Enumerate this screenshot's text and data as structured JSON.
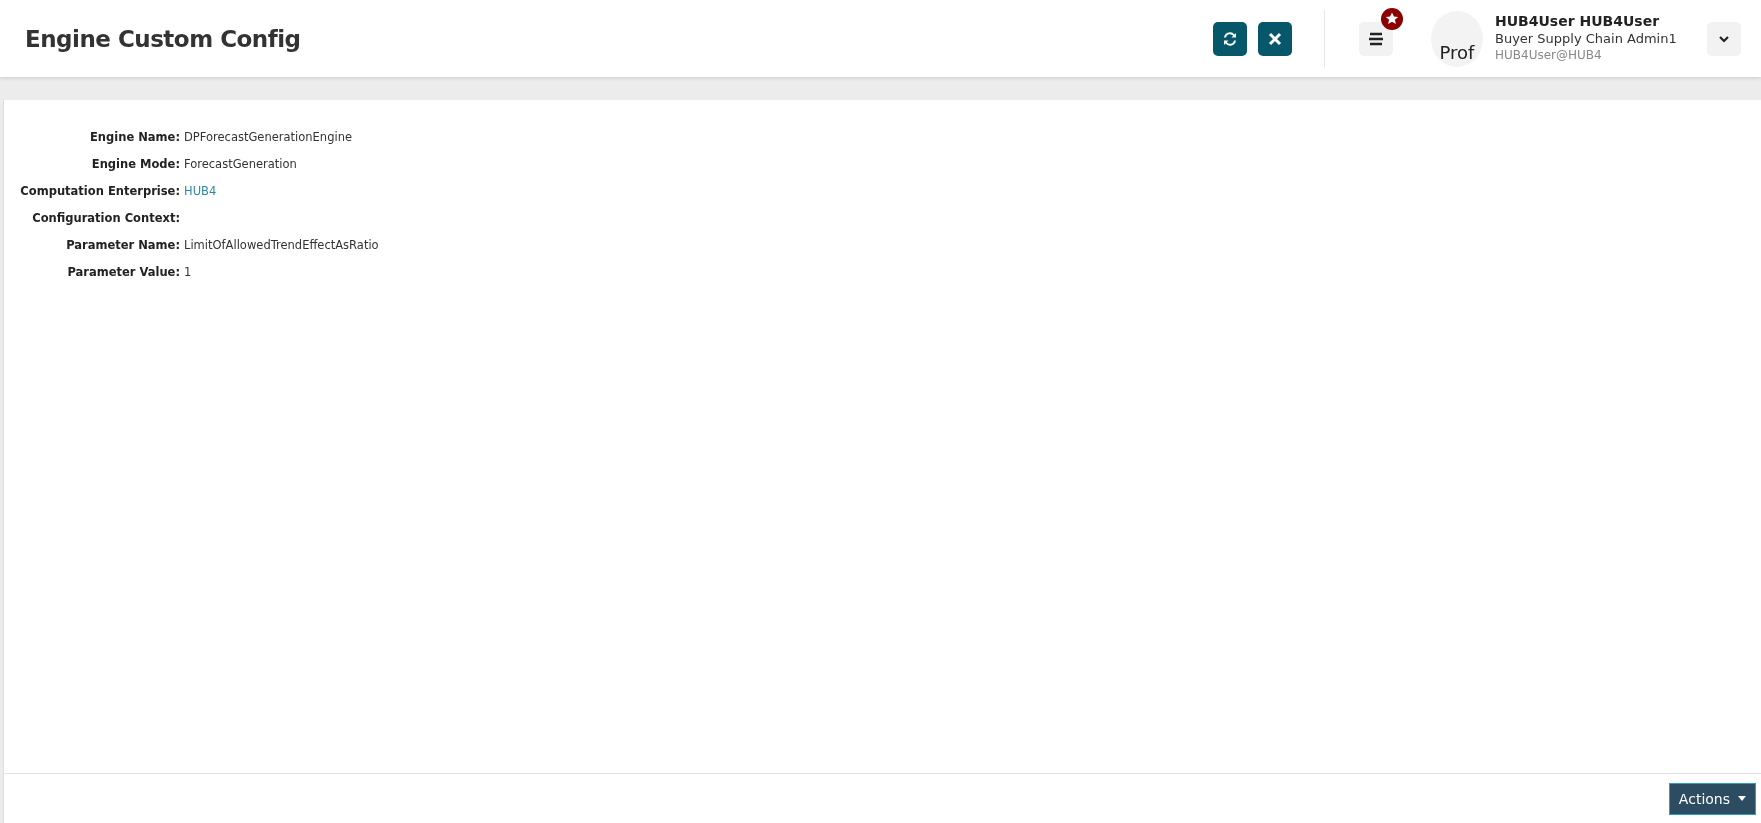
{
  "header": {
    "title": "Engine Custom Config",
    "user": {
      "avatar_text": "Prof",
      "name": "HUB4User HUB4User",
      "role": "Buyer Supply Chain Admin1",
      "login": "HUB4User@HUB4"
    }
  },
  "fields": [
    {
      "label": "Engine Name:",
      "value": "DPForecastGenerationEngine",
      "kind": "text"
    },
    {
      "label": "Engine Mode:",
      "value": "ForecastGeneration",
      "kind": "text"
    },
    {
      "label": "Computation Enterprise:",
      "value": "HUB4",
      "kind": "link"
    },
    {
      "label": "Configuration Context:",
      "kind": "empty"
    },
    {
      "label": "Parameter Name:",
      "value": "LimitOfAllowedTrendEffectAsRatio",
      "kind": "text"
    },
    {
      "label": "Parameter Value:",
      "value": "1",
      "kind": "text"
    }
  ],
  "footer": {
    "actions_button": "Actions"
  }
}
